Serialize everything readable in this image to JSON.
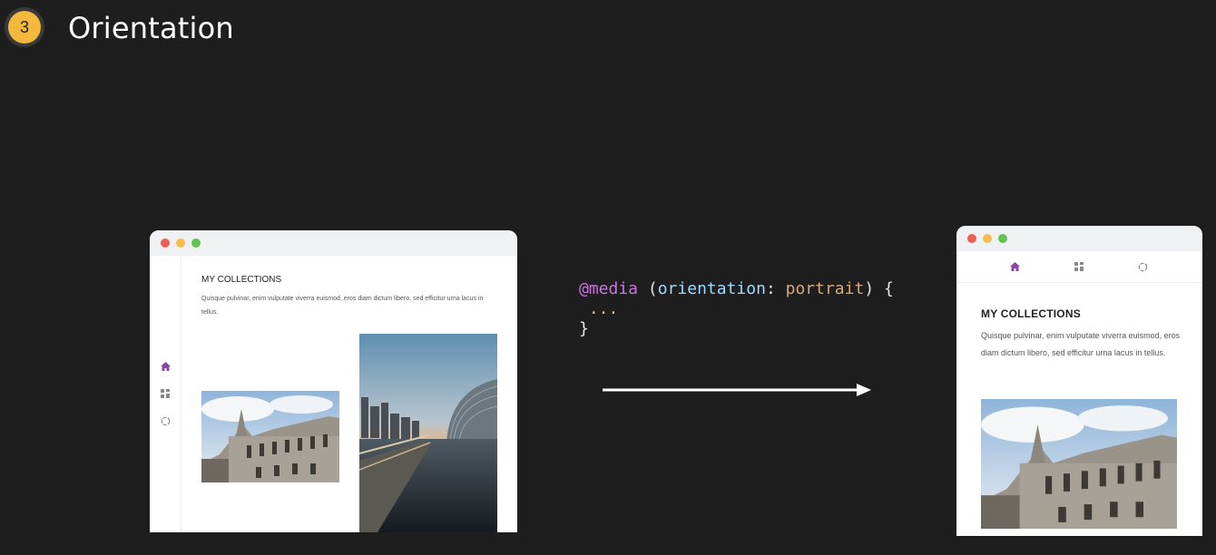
{
  "step": {
    "number": "3",
    "badge_color": "#f3b93c"
  },
  "title": "Orientation",
  "code": {
    "line1": {
      "at_rule": "@media",
      "open_paren": " (",
      "property": "orientation",
      "colon": ": ",
      "value": "portrait",
      "close": ") {"
    },
    "line2": " ...",
    "line3": "}"
  },
  "traffic_lights": {
    "red": "#ec5f56",
    "yellow": "#f4bd4f",
    "green": "#5fc453"
  },
  "left_window": {
    "heading": "MY COLLECTIONS",
    "description": "Quisque pulvinar, enim vulputate viverra euismod, eros diam dictum libero, sed efficitur urna lacus in tellus.",
    "nav_icons": [
      "home-icon",
      "grid-icon",
      "loader-icon"
    ],
    "images": [
      "cathedral-photo",
      "city-skyline-photo"
    ]
  },
  "right_window": {
    "heading": "MY COLLECTIONS",
    "description": "Quisque pulvinar, enim vulputate viverra euismod, eros diam dictum libero, sed efficitur urna lacus in tellus.",
    "nav_icons": [
      "home-icon",
      "grid-icon",
      "loader-icon"
    ],
    "images": [
      "cathedral-photo"
    ]
  },
  "colors": {
    "accent": "#8e44ad",
    "icon_gray": "#8a8a8a"
  }
}
